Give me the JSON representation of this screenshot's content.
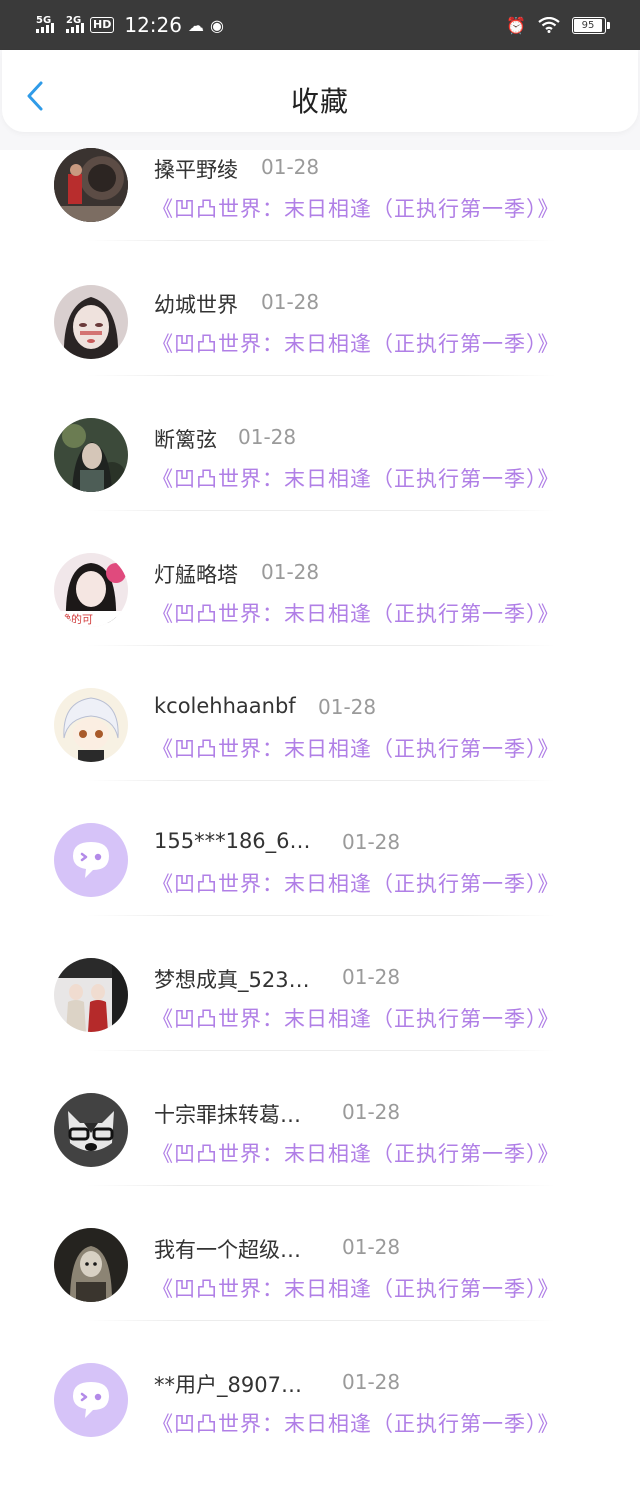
{
  "status_bar": {
    "net1": "5G",
    "net2": "2G",
    "hd": "HD",
    "time": "12:26",
    "battery": "95"
  },
  "header": {
    "title": "收藏"
  },
  "accent_color": "#b07fe6",
  "favorites": [
    {
      "user": "搡平野绫",
      "date": "01-28",
      "work": "《凹凸世界：末日相逢（正执行第一季）》",
      "avatar": "photo-avatar"
    },
    {
      "user": "幼城世界",
      "date": "01-28",
      "work": "《凹凸世界：末日相逢（正执行第一季）》",
      "avatar": "photo-avatar"
    },
    {
      "user": "断篱弦",
      "date": "01-28",
      "work": "《凹凸世界：末日相逢（正执行第一季）》",
      "avatar": "photo-avatar"
    },
    {
      "user": "灯艋略塔",
      "date": "01-28",
      "work": "《凹凸世界：末日相逢（正执行第一季）》",
      "avatar": "photo-avatar"
    },
    {
      "user": "kcolehhaanbf",
      "date": "01-28",
      "work": "《凹凸世界：末日相逢（正执行第一季）》",
      "avatar": "anime-avatar"
    },
    {
      "user": "155***186_6…",
      "date": "01-28",
      "work": "《凹凸世界：末日相逢（正执行第一季）》",
      "avatar": "default-avatar"
    },
    {
      "user": "梦想成真_523…",
      "date": "01-28",
      "work": "《凹凸世界：末日相逢（正执行第一季）》",
      "avatar": "photo-avatar"
    },
    {
      "user": "十宗罪抹转葛…",
      "date": "01-28",
      "work": "《凹凸世界：末日相逢（正执行第一季）》",
      "avatar": "dog-avatar"
    },
    {
      "user": "我有一个超级…",
      "date": "01-28",
      "work": "《凹凸世界：末日相逢（正执行第一季）》",
      "avatar": "photo-avatar"
    },
    {
      "user": "**用户_8907…",
      "date": "01-28",
      "work": "《凹凸世界：末日相逢（正执行第一季）》",
      "avatar": "default-avatar"
    }
  ]
}
